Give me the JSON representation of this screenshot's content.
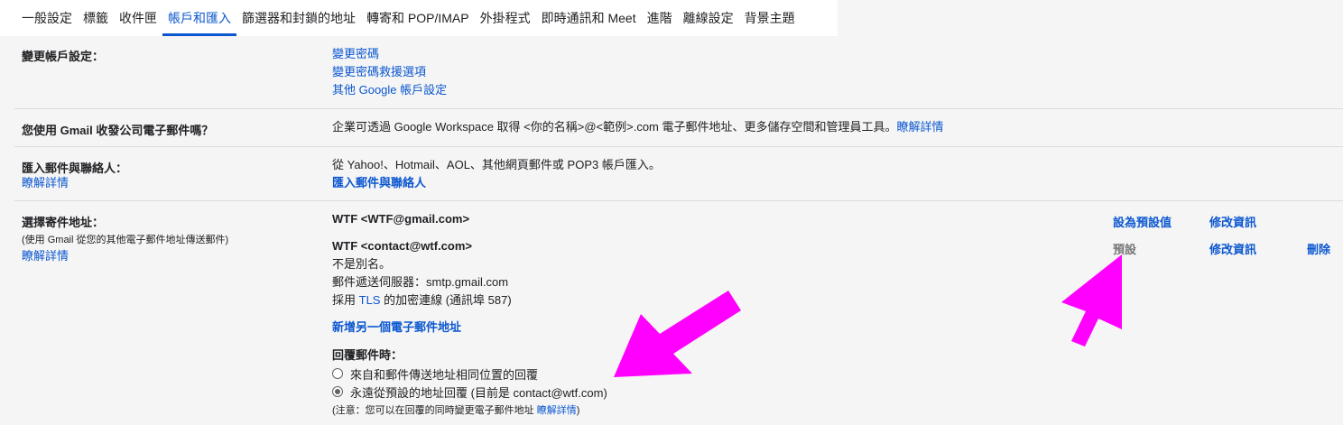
{
  "tabs": [
    {
      "label": "一般設定"
    },
    {
      "label": "標籤"
    },
    {
      "label": "收件匣"
    },
    {
      "label": "帳戶和匯入"
    },
    {
      "label": "篩選器和封鎖的地址"
    },
    {
      "label": "轉寄和 POP/IMAP"
    },
    {
      "label": "外掛程式"
    },
    {
      "label": "即時通訊和 Meet"
    },
    {
      "label": "進階"
    },
    {
      "label": "離線設定"
    },
    {
      "label": "背景主題"
    }
  ],
  "active_tab": "帳戶和匯入",
  "change_account": {
    "label": "變更帳戶設定：",
    "links": [
      "變更密碼",
      "變更密碼救援選項",
      "其他 Google 帳戶設定"
    ]
  },
  "business": {
    "label": "您使用 Gmail 收發公司電子郵件嗎？",
    "text": "企業可透過 Google Workspace 取得 <你的名稱>@<範例>.com 電子郵件地址、更多儲存空間和管理員工具。",
    "learn_more": "瞭解詳情"
  },
  "import": {
    "label": "匯入郵件與聯絡人：",
    "learn_more": "瞭解詳情",
    "text": "從 Yahoo!、Hotmail、AOL、其他網頁郵件或 POP3 帳戶匯入。",
    "action": "匯入郵件與聯絡人"
  },
  "send_as": {
    "label": "選擇寄件地址：",
    "sublabel": "(使用 Gmail 從您的其他電子郵件地址傳送郵件)",
    "learn_more": "瞭解詳情",
    "addresses": [
      {
        "name": "WTF <WTF@gmail.com>",
        "set_default": "設為預設值",
        "edit": "修改資訊"
      },
      {
        "name": "WTF <contact@wtf.com>",
        "alias_note": "不是別名。",
        "smtp": "郵件遞送伺服器：smtp.gmail.com",
        "tls_prefix": "採用",
        "tls_link": "TLS",
        "tls_suffix": "的加密連線 (通訊埠 587)",
        "default_label": "預設",
        "edit": "修改資訊",
        "delete": "刪除"
      }
    ],
    "add_another": "新增另一個電子郵件地址",
    "reply_heading": "回覆郵件時：",
    "reply_options": [
      {
        "label": "來自和郵件傳送地址相同位置的回覆",
        "checked": false
      },
      {
        "label": "永遠從預設的地址回覆 (目前是 contact@wtf.com)",
        "checked": true
      }
    ],
    "note_prefix": "(注意：您可以在回覆的同時變更電子郵件地址",
    "note_link": "瞭解詳情",
    "note_suffix": ")"
  },
  "colors": {
    "link": "#0b57d0",
    "arrow": "#ff00ff",
    "background": "#f5f5f5"
  }
}
